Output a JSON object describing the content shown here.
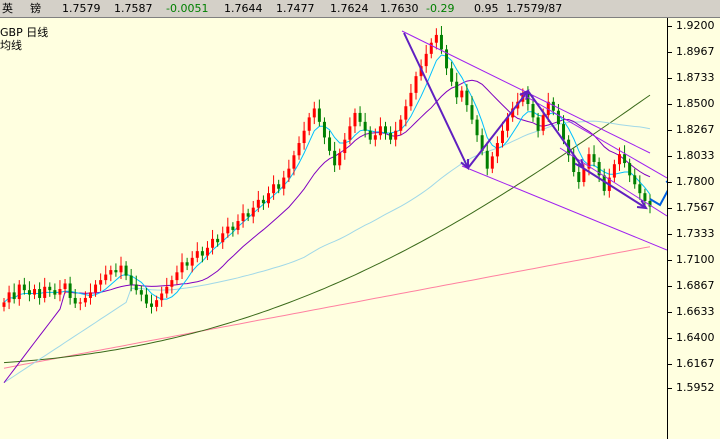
{
  "header": {
    "symbol_a": "英",
    "symbol_b": "镑",
    "last": "1.7579",
    "ask": "1.7587",
    "change": "-0.0051",
    "open": "1.7644",
    "low": "1.7477",
    "high": "1.7624",
    "close": "1.7630",
    "pct": "-0.29",
    "vol": "0.95",
    "quote": "1.7579/87"
  },
  "legend": {
    "line1": "GBP  日线",
    "line2": "均线"
  },
  "colors": {
    "background": "#FFFFE0",
    "up_candle": "#FF0000",
    "down_candle": "#008000",
    "ma_short": "#00C0FF",
    "ma_mid": "#8000C0",
    "ma_long": "#3A6A1A",
    "ma_longest": "#FF80A0",
    "ma_light": "#A0D8E8",
    "trend_lines": "#A020F0",
    "arrows": "#6020C0",
    "blue_arrow": "#0060E0"
  },
  "chart_data": {
    "type": "candlestick",
    "title": "",
    "xlabel": "",
    "ylabel": "",
    "ylim": [
      1.585,
      1.925
    ],
    "y_ticks": [
      "1.9200",
      "1.8967",
      "1.8733",
      "1.8500",
      "1.8267",
      "1.8033",
      "1.7800",
      "1.7567",
      "1.7333",
      "1.7100",
      "1.6867",
      "1.6633",
      "1.6400",
      "1.6167",
      "1.5952"
    ],
    "closes": [
      1.672,
      1.681,
      1.675,
      1.688,
      1.683,
      1.679,
      1.684,
      1.676,
      1.686,
      1.683,
      1.679,
      1.684,
      1.689,
      1.676,
      1.671,
      1.672,
      1.676,
      1.681,
      1.688,
      1.692,
      1.697,
      1.701,
      1.699,
      1.705,
      1.696,
      1.688,
      1.683,
      1.679,
      1.671,
      1.668,
      1.674,
      1.68,
      1.686,
      1.692,
      1.699,
      1.708,
      1.705,
      1.712,
      1.718,
      1.714,
      1.721,
      1.729,
      1.726,
      1.734,
      1.74,
      1.737,
      1.745,
      1.752,
      1.749,
      1.757,
      1.764,
      1.761,
      1.77,
      1.778,
      1.774,
      1.784,
      1.792,
      1.804,
      1.815,
      1.826,
      1.838,
      1.846,
      1.834,
      1.82,
      1.808,
      1.795,
      1.806,
      1.818,
      1.83,
      1.842,
      1.834,
      1.826,
      1.818,
      1.822,
      1.83,
      1.824,
      1.818,
      1.826,
      1.836,
      1.848,
      1.86,
      1.875,
      1.884,
      1.895,
      1.905,
      1.912,
      1.899,
      1.882,
      1.87,
      1.856,
      1.862,
      1.849,
      1.836,
      1.822,
      1.808,
      1.792,
      1.803,
      1.815,
      1.826,
      1.838,
      1.846,
      1.852,
      1.86,
      1.85,
      1.838,
      1.826,
      1.84,
      1.852,
      1.844,
      1.832,
      1.818,
      1.804,
      1.789,
      1.78,
      1.792,
      1.805,
      1.798,
      1.786,
      1.772,
      1.784,
      1.796,
      1.805,
      1.797,
      1.786,
      1.778,
      1.77,
      1.763,
      1.758
    ],
    "ma_short": [
      1.672,
      1.676,
      1.676,
      1.679,
      1.68,
      1.68,
      1.68,
      1.68,
      1.681,
      1.681,
      1.681,
      1.681,
      1.682,
      1.682,
      1.681,
      1.68,
      1.679,
      1.678,
      1.679,
      1.681,
      1.684,
      1.688,
      1.692,
      1.696,
      1.697,
      1.696,
      1.693,
      1.69,
      1.685,
      1.68,
      1.677,
      1.675,
      1.675,
      1.677,
      1.681,
      1.687,
      1.693,
      1.7,
      1.705,
      1.709,
      1.714,
      1.719,
      1.723,
      1.727,
      1.731,
      1.735,
      1.74,
      1.744,
      1.748,
      1.752,
      1.756,
      1.76,
      1.764,
      1.768,
      1.772,
      1.777,
      1.782,
      1.789,
      1.797,
      1.806,
      1.816,
      1.826,
      1.83,
      1.83,
      1.827,
      1.82,
      1.815,
      1.815,
      1.817,
      1.822,
      1.826,
      1.827,
      1.826,
      1.825,
      1.825,
      1.824,
      1.824,
      1.825,
      1.827,
      1.832,
      1.839,
      1.848,
      1.857,
      1.867,
      1.878,
      1.889,
      1.894,
      1.893,
      1.889,
      1.881,
      1.874,
      1.865,
      1.856,
      1.846,
      1.834,
      1.82,
      1.813,
      1.81,
      1.812,
      1.817,
      1.824,
      1.831,
      1.839,
      1.843,
      1.843,
      1.84,
      1.839,
      1.841,
      1.842,
      1.84,
      1.835,
      1.828,
      1.819,
      1.808,
      1.799,
      1.795,
      1.795,
      1.792,
      1.789,
      1.787,
      1.787,
      1.788,
      1.789,
      1.789,
      1.785,
      1.78,
      1.775,
      1.769
    ]
  }
}
